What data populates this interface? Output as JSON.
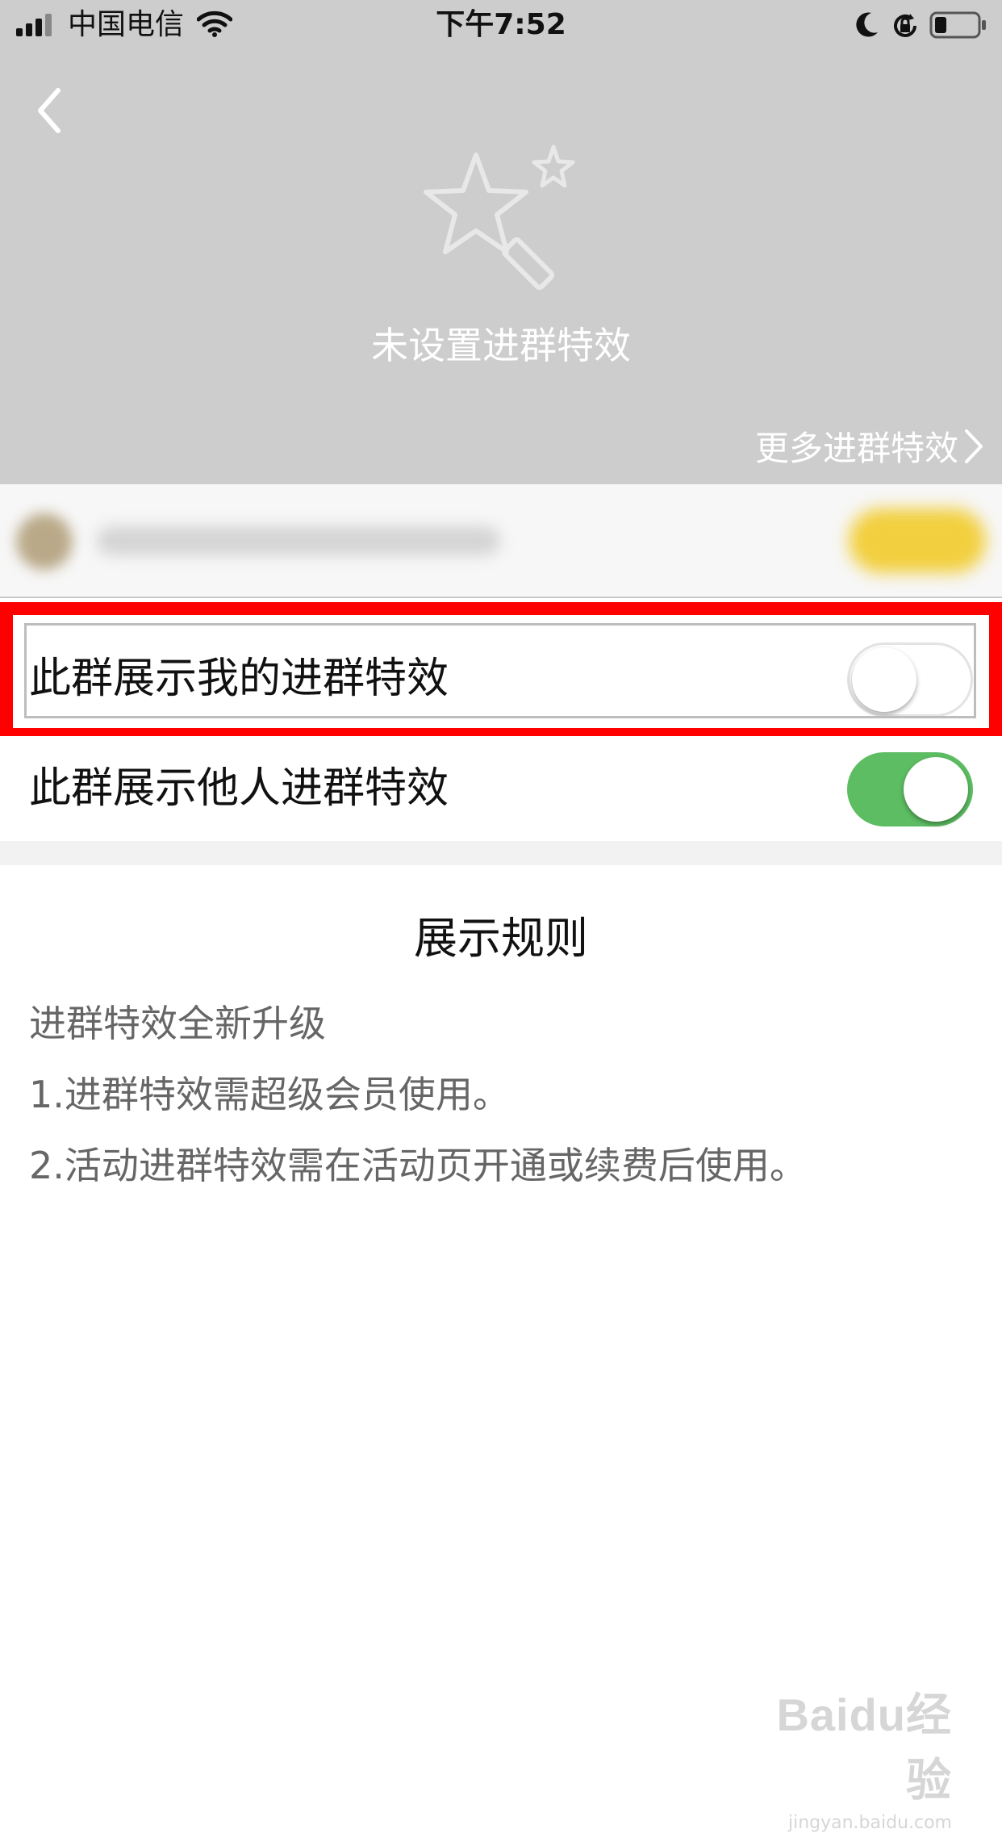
{
  "status_bar": {
    "carrier": "中国电信",
    "time": "下午7:52",
    "signal_icon": "cellular-signal-icon",
    "wifi_icon": "wifi-icon",
    "moon_icon": "do-not-disturb-icon",
    "lock_icon": "orientation-lock-icon",
    "battery_icon": "battery-icon"
  },
  "header": {
    "back_icon": "chevron-left-icon",
    "wand_icon": "magic-wand-star-icon",
    "title": "未设置进群特效",
    "more_link": "更多进群特效",
    "more_icon": "chevron-right-icon"
  },
  "settings": {
    "show_my_effect": {
      "label": "此群展示我的进群特效",
      "enabled": false
    },
    "show_others_effect": {
      "label": "此群展示他人进群特效",
      "enabled": true
    }
  },
  "rules": {
    "title": "展示规则",
    "lines": [
      "进群特效全新升级",
      "1.进群特效需超级会员使用。",
      "2.活动进群特效需在活动页开通或续费后使用。"
    ]
  },
  "watermark": {
    "logo": "Baidu经验",
    "url": "jingyan.baidu.com"
  },
  "colors": {
    "header_bg": "#cdcdcd",
    "switch_on": "#5dbd63",
    "highlight": "#ff0000"
  }
}
